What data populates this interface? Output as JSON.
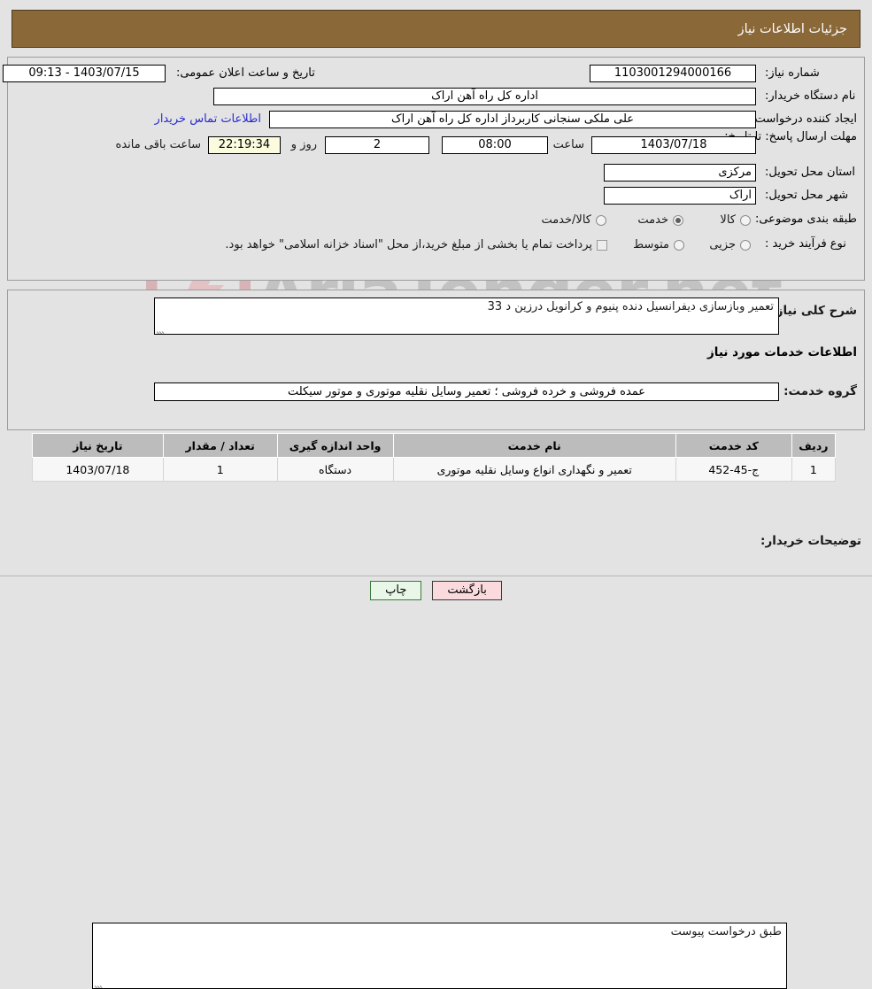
{
  "header": {
    "title": "جزئیات اطلاعات نیاز"
  },
  "colors": {
    "header_bg": "#8a6838",
    "page_bg": "#e3e3e3",
    "link": "#2a2ad0",
    "countdown_bg": "#fbfbe0",
    "back_button_bg": "#fadadd",
    "print_button_bg": "#e9f7e9",
    "table_header_bg": "#bcbcbc"
  },
  "watermark": {
    "text": "AriaTender.net"
  },
  "form": {
    "need_number": {
      "label": "شماره نیاز:",
      "value": "1103001294000166"
    },
    "announce_datetime": {
      "label": "تاریخ و ساعت اعلان عمومی:",
      "value": "1403/07/15 - 09:13"
    },
    "buyer_org": {
      "label": "نام دستگاه خریدار:",
      "value": "اداره کل راه آهن اراک"
    },
    "request_creator": {
      "label": "ایجاد کننده درخواست:",
      "value": "علی ملکی سنجانی کاربرداز اداره کل راه آهن اراک"
    },
    "buyer_contact_link": "اطلاعات تماس خریدار",
    "deadline": {
      "label": "مهلت ارسال پاسخ: تا تاریخ:",
      "date": "1403/07/18",
      "hour_label": "ساعت",
      "hour": "08:00",
      "days": "2",
      "days_label": "روز و",
      "countdown": "22:19:34",
      "remaining_label": "ساعت باقی مانده"
    },
    "delivery_province": {
      "label": "استان محل تحویل:",
      "value": "مرکزی"
    },
    "delivery_city": {
      "label": "شهر محل تحویل:",
      "value": "اراک"
    },
    "subject_category": {
      "label": "طبقه بندی موضوعی:",
      "options": [
        {
          "label": "کالا",
          "selected": false
        },
        {
          "label": "خدمت",
          "selected": true
        },
        {
          "label": "کالا/خدمت",
          "selected": false
        }
      ]
    },
    "purchase_process": {
      "label": "نوع فرآیند خرید :",
      "options": [
        {
          "label": "جزیی",
          "selected": false
        },
        {
          "label": "متوسط",
          "selected": false
        }
      ]
    },
    "treasury_checkbox": {
      "checked": false,
      "label": "پرداخت تمام یا بخشی از مبلغ خرید،از محل \"اسناد خزانه اسلامی\" خواهد بود."
    },
    "general_description": {
      "label": "شرح کلی نیاز:",
      "value": "تعمیر وبازسازی دیفرانسیل دنده پنیوم و کرانویل درزین د 33"
    },
    "services_section_title": "اطلاعات خدمات مورد نیاز",
    "service_group": {
      "label": "گروه خدمت:",
      "value": "عمده فروشی و خرده فروشی ؛ تعمیر وسایل نقلیه موتوری و موتور سیکلت"
    },
    "buyer_notes": {
      "label": "توضیحات خریدار:",
      "value": "طبق درخواست پیوست"
    }
  },
  "table": {
    "headers": [
      "ردیف",
      "کد خدمت",
      "نام خدمت",
      "واحد اندازه گیری",
      "تعداد / مقدار",
      "تاریخ نیاز"
    ],
    "rows": [
      {
        "row": "1",
        "code": "ج-45-452",
        "name": "تعمیر و نگهداری انواع وسایل نقلیه موتوری",
        "unit": "دستگاه",
        "qty": "1",
        "date": "1403/07/18"
      }
    ]
  },
  "buttons": {
    "back": "بازگشت",
    "print": "چاپ"
  }
}
